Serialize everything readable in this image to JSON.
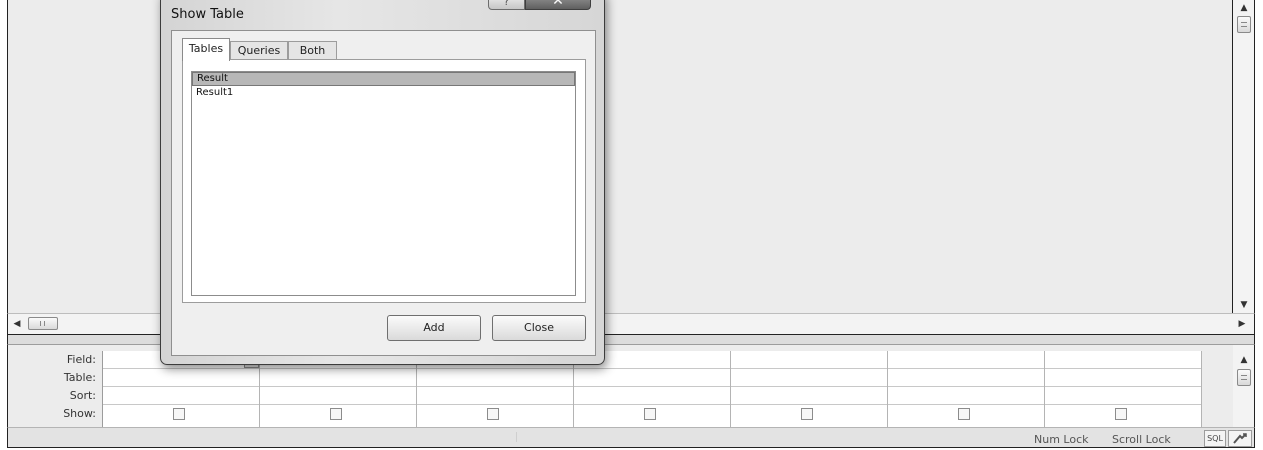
{
  "dialog": {
    "title": "Show Table",
    "help_icon": "question-mark-icon",
    "close_icon": "close-x-icon",
    "tabs": [
      {
        "label": "Tables",
        "active": true
      },
      {
        "label": "Queries",
        "active": false
      },
      {
        "label": "Both",
        "active": false
      }
    ],
    "list_items": [
      {
        "label": "Result",
        "selected": true
      },
      {
        "label": "Result1",
        "selected": false
      }
    ],
    "add_label": "Add",
    "close_label": "Close"
  },
  "grid": {
    "row_labels": [
      "Field:",
      "Table:",
      "Sort:",
      "Show:"
    ],
    "column_count": 7
  },
  "status_bar": {
    "num_lock": "Num Lock",
    "scroll_lock": "Scroll Lock",
    "sql_view_label": "SQL"
  },
  "colors": {
    "design_area": "#ececec",
    "selected_item": "#b7b7b7",
    "close_button": "#5f5f5f"
  }
}
